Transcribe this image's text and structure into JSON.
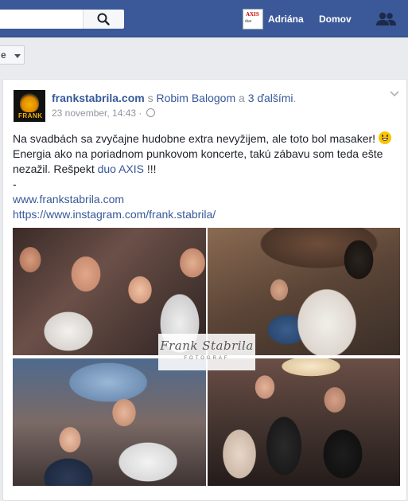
{
  "topbar": {
    "user_name": "Adriána",
    "home_label": "Domov",
    "avatar_text": "AXIS",
    "avatar_subtext": "duo"
  },
  "filter": {
    "label": "e"
  },
  "post": {
    "page_name": "frankstabrila.com",
    "with_prefix": "s",
    "with_person": "Robim Balogom",
    "and_word": "a",
    "others": "3 ďalšími",
    "trailing": ".",
    "avatar_label": "FRANK",
    "timestamp": "23 november, 14:43",
    "separator": "·",
    "text_1": "Na svadbách sa zvyčajne hudobne extra nevyžijem, ale toto bol masaker!",
    "text_2": " Energia ako na poriadnom punkovom koncerte, takú zábavu som teda ešte nezažil. Rešpekt",
    "mention": "duo AXIS",
    "text_3": " !!!",
    "dash": "-",
    "link_1": "www.frankstabrila.com",
    "link_2": "https://www.instagram.com/frank.stabrila/"
  },
  "watermark": {
    "title": "Frank Stabrila",
    "subtitle": "FOTOGRAF"
  },
  "icons": {
    "search": "search-icon",
    "friends": "friends-icon",
    "chevron": "chevron-down-icon",
    "globe": "globe-icon",
    "emoji": "smiley-emoji"
  },
  "colors": {
    "brand": "#3b5998",
    "link": "#365899",
    "meta": "#90949c"
  }
}
